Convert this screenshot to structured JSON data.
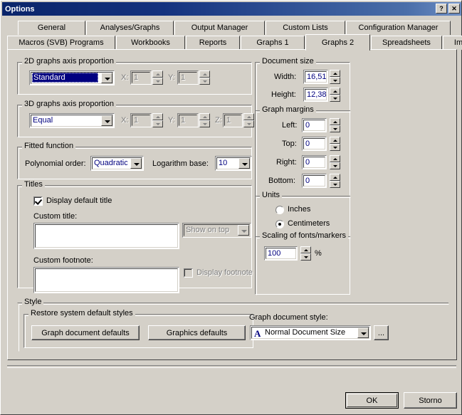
{
  "window": {
    "title": "Options",
    "help_button": "?",
    "close_button": "✕"
  },
  "tabs": {
    "row1": [
      {
        "label": "General",
        "active": false
      },
      {
        "label": "Analyses/Graphs",
        "active": false
      },
      {
        "label": "Output Manager",
        "active": false
      },
      {
        "label": "Custom Lists",
        "active": false
      },
      {
        "label": "Configuration Manager",
        "active": false
      }
    ],
    "row2": [
      {
        "label": "Macros (SVB) Programs",
        "active": false
      },
      {
        "label": "Workbooks",
        "active": false
      },
      {
        "label": "Reports",
        "active": false
      },
      {
        "label": "Graphs 1",
        "active": false
      },
      {
        "label": "Graphs 2",
        "active": true
      },
      {
        "label": "Spreadsheets",
        "active": false
      },
      {
        "label": "Import",
        "active": false
      }
    ]
  },
  "axis2d": {
    "group_label": "2D graphs axis proportion",
    "combo_value": "Standard",
    "x_label": "X:",
    "x_value": "1",
    "y_label": "Y:",
    "y_value": "1"
  },
  "axis3d": {
    "group_label": "3D graphs axis proportion",
    "combo_value": "Equal",
    "x_label": "X:",
    "x_value": "1",
    "y_label": "Y:",
    "y_value": "1",
    "z_label": "Z:",
    "z_value": "1"
  },
  "fitted": {
    "group_label": "Fitted function",
    "poly_label": "Polynomial order:",
    "poly_value": "Quadratic",
    "log_label": "Logarithm base:",
    "log_value": "10"
  },
  "titles": {
    "group_label": "Titles",
    "display_default_title": "Display default title",
    "display_default_title_checked": true,
    "custom_title_label": "Custom title:",
    "custom_title_value": "",
    "show_on_top_value": "Show on top",
    "custom_footnote_label": "Custom footnote:",
    "custom_footnote_value": "",
    "display_footnote_label": "Display footnote",
    "display_footnote_checked": false
  },
  "document_size": {
    "group_label": "Document size",
    "width_label": "Width:",
    "width_value": "16,51",
    "height_label": "Height:",
    "height_value": "12,38"
  },
  "graph_margins": {
    "group_label": "Graph margins",
    "left_label": "Left:",
    "left_value": "0",
    "top_label": "Top:",
    "top_value": "0",
    "right_label": "Right:",
    "right_value": "0",
    "bottom_label": "Bottom:",
    "bottom_value": "0"
  },
  "units": {
    "group_label": "Units",
    "inches_label": "Inches",
    "centimeters_label": "Centimeters",
    "selected": "Centimeters"
  },
  "scaling": {
    "group_label": "Scaling of fonts/markers",
    "value": "100",
    "percent_sign": "%"
  },
  "style": {
    "group_label": "Style",
    "restore_group_label": "Restore system default styles",
    "graph_document_defaults": "Graph document defaults",
    "graphics_defaults": "Graphics defaults",
    "doc_style_label": "Graph document style:",
    "doc_style_value": "Normal Document Size",
    "doc_style_icon": "A",
    "browse_button": "..."
  },
  "footer": {
    "ok": "OK",
    "cancel": "Storno"
  },
  "colors": {
    "face": "#d4d0c8",
    "title_gradient_start": "#0a246a",
    "title_gradient_end": "#6e8fc4",
    "field_text": "#00007f",
    "selection": "#000080"
  }
}
